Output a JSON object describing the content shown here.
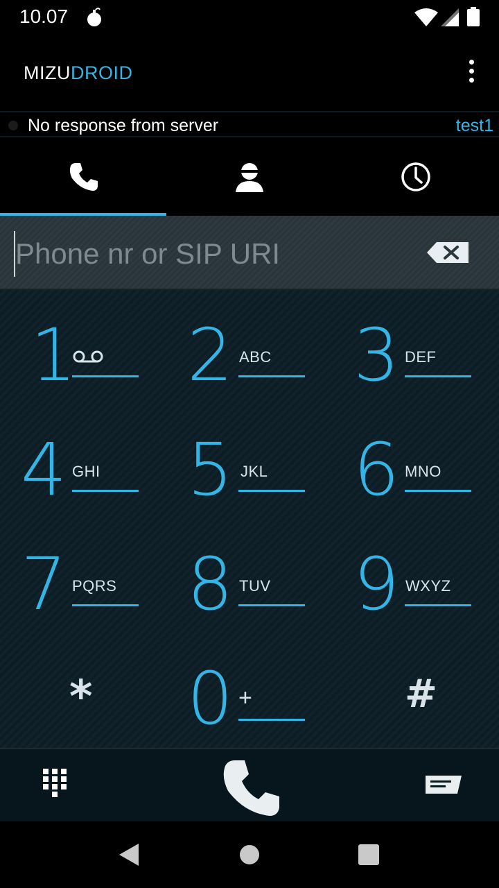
{
  "status_bar": {
    "time": "10.07"
  },
  "app": {
    "title_part1": "MIZU",
    "title_part2": "DROID"
  },
  "registration": {
    "message": "No response from server",
    "account": "test1"
  },
  "tabs": [
    {
      "id": "dialer",
      "icon": "phone-icon"
    },
    {
      "id": "contacts",
      "icon": "contact-icon"
    },
    {
      "id": "history",
      "icon": "clock-icon"
    }
  ],
  "dial_input": {
    "value": "",
    "placeholder": "Phone nr or SIP URI"
  },
  "keypad": {
    "k1": {
      "digit": "1",
      "letters": ""
    },
    "k2": {
      "digit": "2",
      "letters": "ABC"
    },
    "k3": {
      "digit": "3",
      "letters": "DEF"
    },
    "k4": {
      "digit": "4",
      "letters": "GHI"
    },
    "k5": {
      "digit": "5",
      "letters": "JKL"
    },
    "k6": {
      "digit": "6",
      "letters": "MNO"
    },
    "k7": {
      "digit": "7",
      "letters": "PQRS"
    },
    "k8": {
      "digit": "8",
      "letters": "TUV"
    },
    "k9": {
      "digit": "9",
      "letters": "WXYZ"
    },
    "kstar": {
      "digit": "*"
    },
    "k0": {
      "digit": "0",
      "letters": "+"
    },
    "khash": {
      "digit": "#"
    }
  },
  "colors": {
    "accent": "#35b5e5",
    "background": "#000000",
    "keypad_bg": "#0f1f27"
  }
}
